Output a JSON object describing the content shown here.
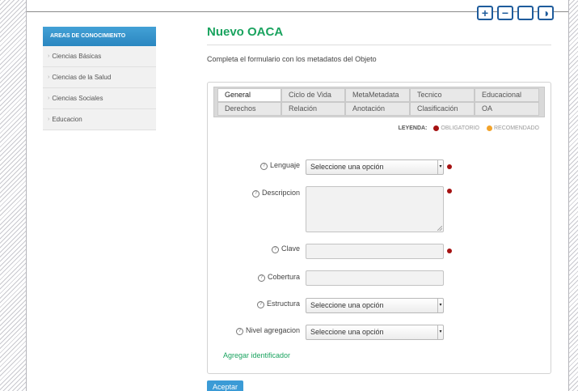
{
  "window_controls": {
    "add_label": "+",
    "remove_label": "−",
    "square_label": "",
    "contrast_label": "◑"
  },
  "sidebar": {
    "header": "AREAS DE CONOCIMIENTO",
    "items": [
      {
        "label": "Ciencias Básicas"
      },
      {
        "label": "Ciencias de la Salud"
      },
      {
        "label": "Ciencias Sociales"
      },
      {
        "label": "Educacion"
      }
    ]
  },
  "page": {
    "title": "Nuevo OACA",
    "intro": "Completa el formulario con los metadatos del Objeto"
  },
  "tabs": {
    "row1": [
      "General",
      "Ciclo de Vida",
      "MetaMetadata",
      "Tecnico",
      "Educacional"
    ],
    "row2": [
      "Derechos",
      "Relación",
      "Anotación",
      "Clasificación",
      "OA"
    ],
    "active": "General"
  },
  "legend": {
    "title": "LEYENDA:",
    "required": "OBLIGATORIO",
    "recommended": "RECOMENDADO",
    "required_color": "#a51212",
    "recommended_color": "#f2a32a"
  },
  "form": {
    "lenguaje": {
      "label": "Lenguaje",
      "value": "Seleccione una opción"
    },
    "descripcion": {
      "label": "Descripcion",
      "value": ""
    },
    "clave": {
      "label": "Clave",
      "value": ""
    },
    "cobertura": {
      "label": "Cobertura",
      "value": ""
    },
    "estructura": {
      "label": "Estructura",
      "value": "Seleccione una opción"
    },
    "nivel_agregacion": {
      "label": "Nivel agregacion",
      "value": "Seleccione una opción"
    },
    "help_glyph": "?"
  },
  "add_identifier_link": "Agregar identificador",
  "accept_button": "Aceptar",
  "colors": {
    "accent_green": "#1aa35f",
    "accent_blue": "#2a86c0",
    "required_dot": "#a51212"
  }
}
